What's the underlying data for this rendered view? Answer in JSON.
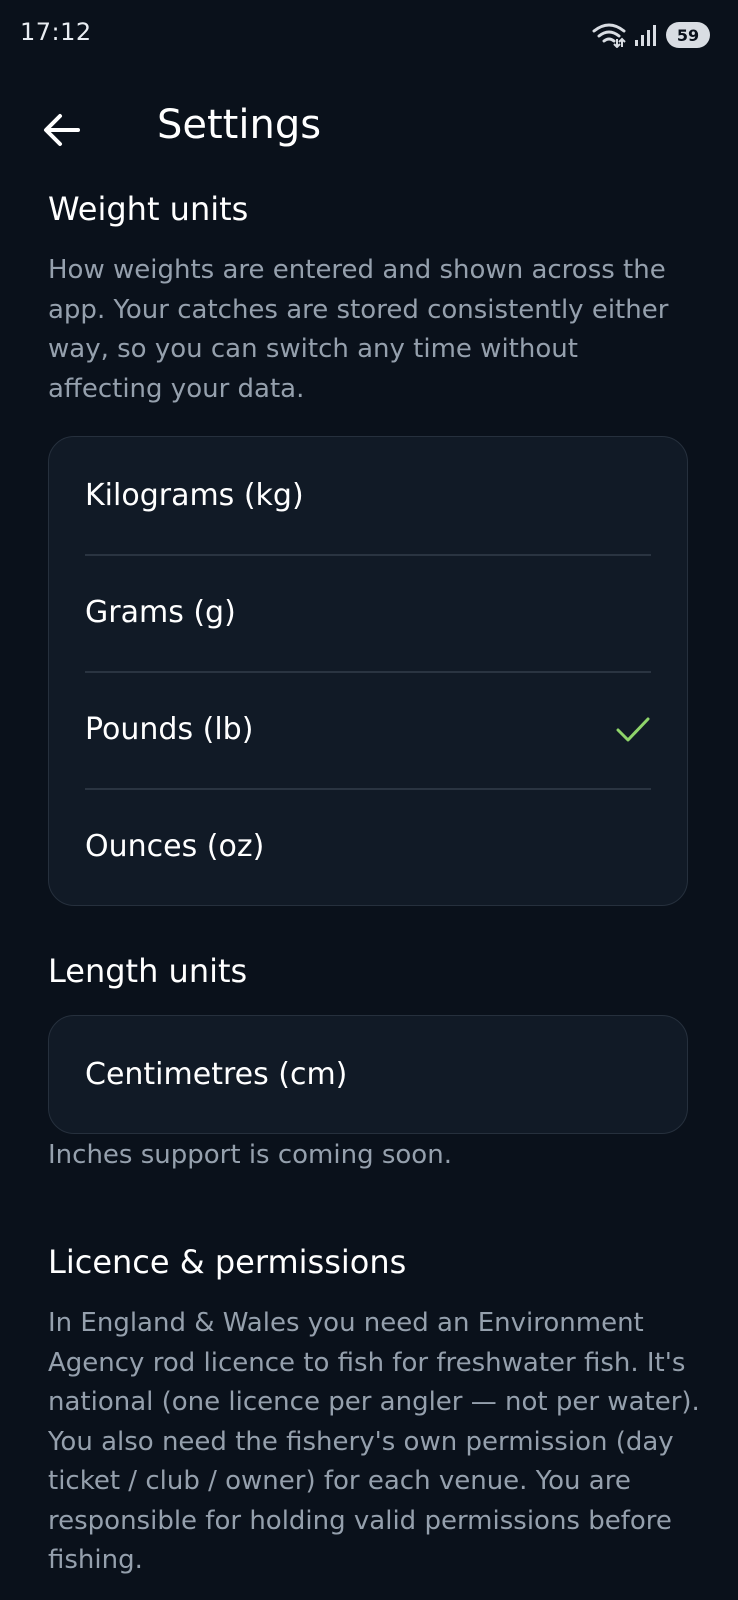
{
  "status_bar": {
    "time": "17:12",
    "battery": "59",
    "icons": [
      "wifi-icon",
      "signal-icon",
      "battery-icon"
    ]
  },
  "header": {
    "title": "Settings",
    "back_icon": "arrow-left-icon"
  },
  "weight_units": {
    "title": "Weight units",
    "description": "How weights are entered and shown across the app. Your catches are stored consistently either way, so you can switch any time without affecting your data.",
    "options": [
      {
        "label": "Kilograms (kg)",
        "selected": false
      },
      {
        "label": "Grams (g)",
        "selected": false
      },
      {
        "label": "Pounds (lb)",
        "selected": true
      },
      {
        "label": "Ounces (oz)",
        "selected": false
      }
    ]
  },
  "length_units": {
    "title": "Length units",
    "options": [
      {
        "label": "Centimetres (cm)",
        "selected": false
      }
    ],
    "note": "Inches support is coming soon."
  },
  "licence": {
    "title": "Licence & permissions",
    "description": "In England & Wales you need an Environment Agency rod licence to fish for freshwater fish. It's national (one licence per angler — not per water). You also need the fishery's own permission (day ticket / club / owner) for each venue. You are responsible for holding valid permissions before fishing."
  },
  "colors": {
    "background": "#0a111b",
    "card": "#111a26",
    "muted_text": "#95a0ad",
    "check": "#8fd46a"
  }
}
